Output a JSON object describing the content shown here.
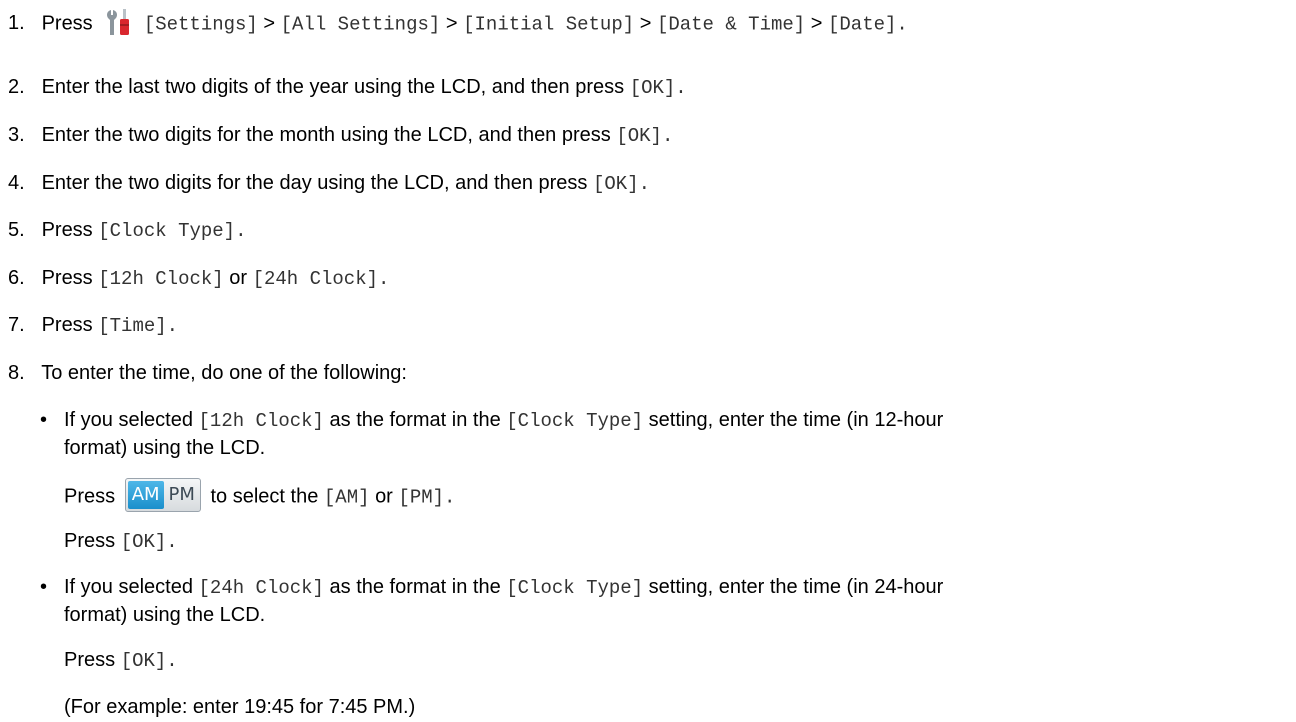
{
  "steps": [
    {
      "num": "1.",
      "press": "Press",
      "icon": "settings-icon",
      "path": [
        "[Settings]",
        "[All Settings]",
        "[Initial Setup]",
        "[Date & Time]",
        "[Date]."
      ],
      "sep": ">"
    },
    {
      "num": "2.",
      "text": "Enter the last two digits of the year using the LCD, and then press",
      "code": "[OK]."
    },
    {
      "num": "3.",
      "text": "Enter the two digits for the month using the LCD, and then press",
      "code": "[OK]."
    },
    {
      "num": "4.",
      "text": "Enter the two digits for the day using the LCD, and then press",
      "code": "[OK]."
    },
    {
      "num": "5.",
      "text": "Press",
      "code": "[Clock Type]."
    },
    {
      "num": "6.",
      "text": "Press",
      "code": "[12h Clock]",
      "or": "or",
      "code2": "[24h Clock]."
    },
    {
      "num": "7.",
      "text": "Press",
      "code": "[Time]."
    },
    {
      "num": "8.",
      "text": "To enter the time, do one of the following:"
    }
  ],
  "bullets": [
    {
      "mark": "•",
      "line1_a": "If you selected",
      "line1_code1": "[12h Clock]",
      "line1_b": "as the format in the",
      "line1_code2": "[Clock Type]",
      "line1_c": "setting, enter the time (in 12-hour",
      "line2": "format) using the LCD.",
      "press_a": "Press",
      "button": {
        "am": "AM",
        "pm": "PM"
      },
      "press_b": "to select the",
      "press_code1": "[AM]",
      "press_or": "or",
      "press_code2": "[PM].",
      "ok_press": "Press",
      "ok_code": "[OK]."
    },
    {
      "mark": "•",
      "line1_a": "If you selected",
      "line1_code1": "[24h Clock]",
      "line1_b": "as the format in the",
      "line1_code2": "[Clock Type]",
      "line1_c": "setting, enter the time (in 24-hour",
      "line2": "format) using the LCD.",
      "ok_press": "Press",
      "ok_code": "[OK].",
      "example": "(For example: enter 19:45 for 7:45 PM.)"
    }
  ],
  "colors": {
    "text": "#000000",
    "code": "#333333",
    "am_bg": "#1a8fcc"
  }
}
